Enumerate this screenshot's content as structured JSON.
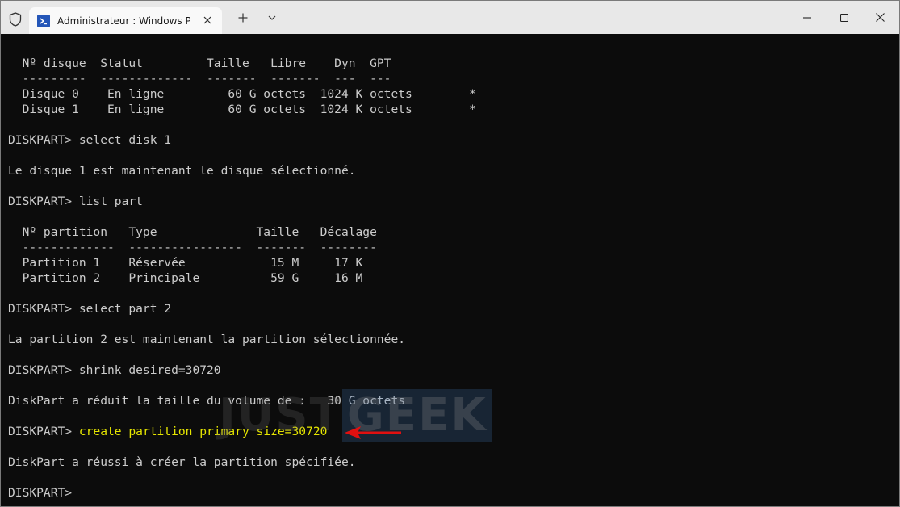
{
  "window": {
    "tab_title": "Administrateur : Windows Pov",
    "icons": {
      "shield": "shield-icon",
      "powershell": "powershell-icon",
      "close_tab": "close-icon",
      "new_tab": "plus-icon",
      "dropdown": "chevron-down-icon",
      "minimize": "minimize-icon",
      "maximize": "maximize-icon",
      "close": "close-icon"
    }
  },
  "terminal": {
    "lines": [
      "",
      "  Nº disque  Statut         Taille   Libre    Dyn  GPT",
      "  ---------  -------------  -------  -------  ---  ---",
      "  Disque 0    En ligne         60 G octets  1024 K octets        *",
      "  Disque 1    En ligne         60 G octets  1024 K octets        *",
      "",
      "DISKPART> select disk 1",
      "",
      "Le disque 1 est maintenant le disque sélectionné.",
      "",
      "DISKPART> list part",
      "",
      "  Nº partition   Type              Taille   Décalage",
      "  -------------  ----------------  -------  --------",
      "  Partition 1    Réservée            15 M     17 K",
      "  Partition 2    Principale          59 G     16 M",
      "",
      "DISKPART> select part 2",
      "",
      "La partition 2 est maintenant la partition sélectionnée.",
      "",
      "DISKPART> shrink desired=30720",
      "",
      "DiskPart a réduit la taille du volume de :   30 G octets",
      "",
      "",
      "",
      "DiskPart a réussi à créer la partition spécifiée.",
      "",
      "DISKPART>"
    ],
    "highlight_prompt": "DISKPART> ",
    "highlight_command": "create partition primary size=30720",
    "highlight_color": "#e5e500",
    "text_color": "#cccccc",
    "background_color": "#0c0c0c"
  },
  "watermark": {
    "part1": "JUST",
    "part2": "GEEK"
  },
  "annotation": {
    "arrow_color": "#e01010"
  }
}
